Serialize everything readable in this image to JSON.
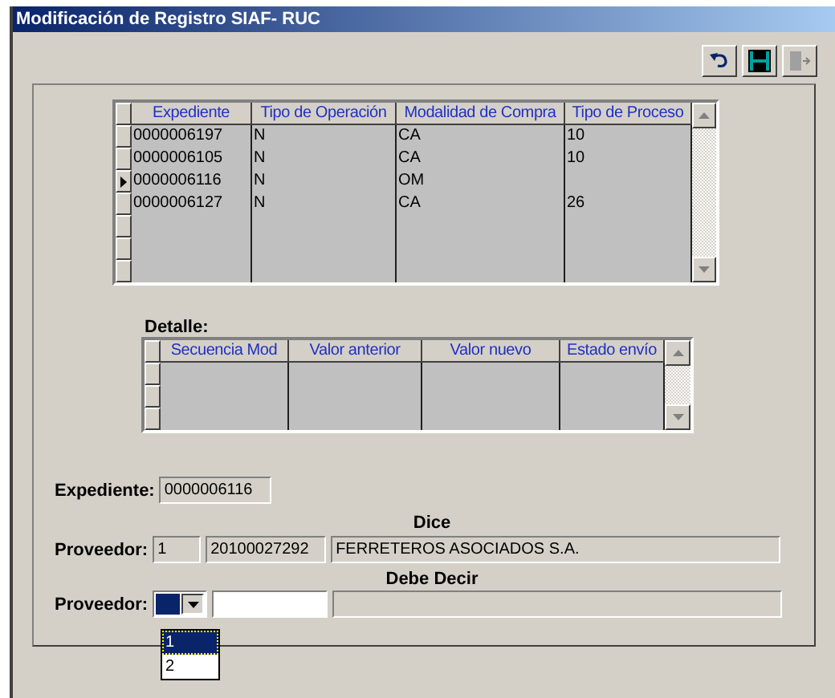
{
  "window": {
    "title": "Modificación de Registro SIAF- RUC"
  },
  "toolbar": [
    {
      "kind": "undo",
      "disabled": false
    },
    {
      "kind": "save",
      "disabled": false
    },
    {
      "kind": "exit",
      "disabled": true
    }
  ],
  "main_grid": {
    "columns": [
      "Expediente",
      "Tipo de Operación",
      "Modalidad de Compra",
      "Tipo de Proceso"
    ],
    "rows": [
      {
        "cells": [
          "0000006197",
          "N",
          "CA",
          "10"
        ],
        "selected": false
      },
      {
        "cells": [
          "0000006105",
          "N",
          "CA",
          "10"
        ],
        "selected": false
      },
      {
        "cells": [
          "0000006116",
          "N",
          "OM",
          ""
        ],
        "selected": true
      },
      {
        "cells": [
          "0000006127",
          "N",
          "CA",
          "26"
        ],
        "selected": false
      }
    ]
  },
  "detail": {
    "label": "Detalle:",
    "columns": [
      "Secuencia Mod",
      "Valor anterior",
      "Valor nuevo",
      "Estado envío"
    ]
  },
  "form": {
    "expediente": {
      "label": "Expediente:",
      "value": "0000006116"
    },
    "dice": {
      "heading": "Dice",
      "label": "Proveedor:",
      "values": [
        "1",
        "20100027292",
        "FERRETEROS ASOCIADOS S.A."
      ]
    },
    "debe_decir": {
      "heading": "Debe Decir",
      "label": "Proveedor:",
      "expanded": true,
      "options": [
        {
          "label": "1",
          "selected": true
        },
        {
          "label": "2",
          "selected": false
        }
      ]
    }
  }
}
